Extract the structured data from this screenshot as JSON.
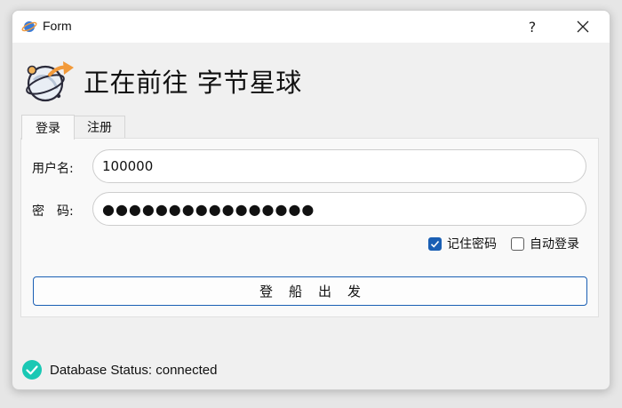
{
  "window": {
    "title": "Form",
    "help_label": "?"
  },
  "header": {
    "title": "正在前往 字节星球"
  },
  "tabs": [
    {
      "label": "登录"
    },
    {
      "label": "注册"
    }
  ],
  "login_form": {
    "username_label": "用户名:",
    "username_value": "100000",
    "password_label": "密　码:",
    "password_value": "●●●●●●●●●●●●●●●●",
    "remember_label": "记住密码",
    "remember_checked": true,
    "auto_login_label": "自动登录",
    "auto_login_checked": false,
    "submit_label": "登船出发"
  },
  "status": {
    "text": "Database Status: connected",
    "color": "#1ac8b4"
  },
  "colors": {
    "accent": "#1a5fb4",
    "status_ok": "#1ac8b4",
    "arrow": "#f29a3a"
  }
}
